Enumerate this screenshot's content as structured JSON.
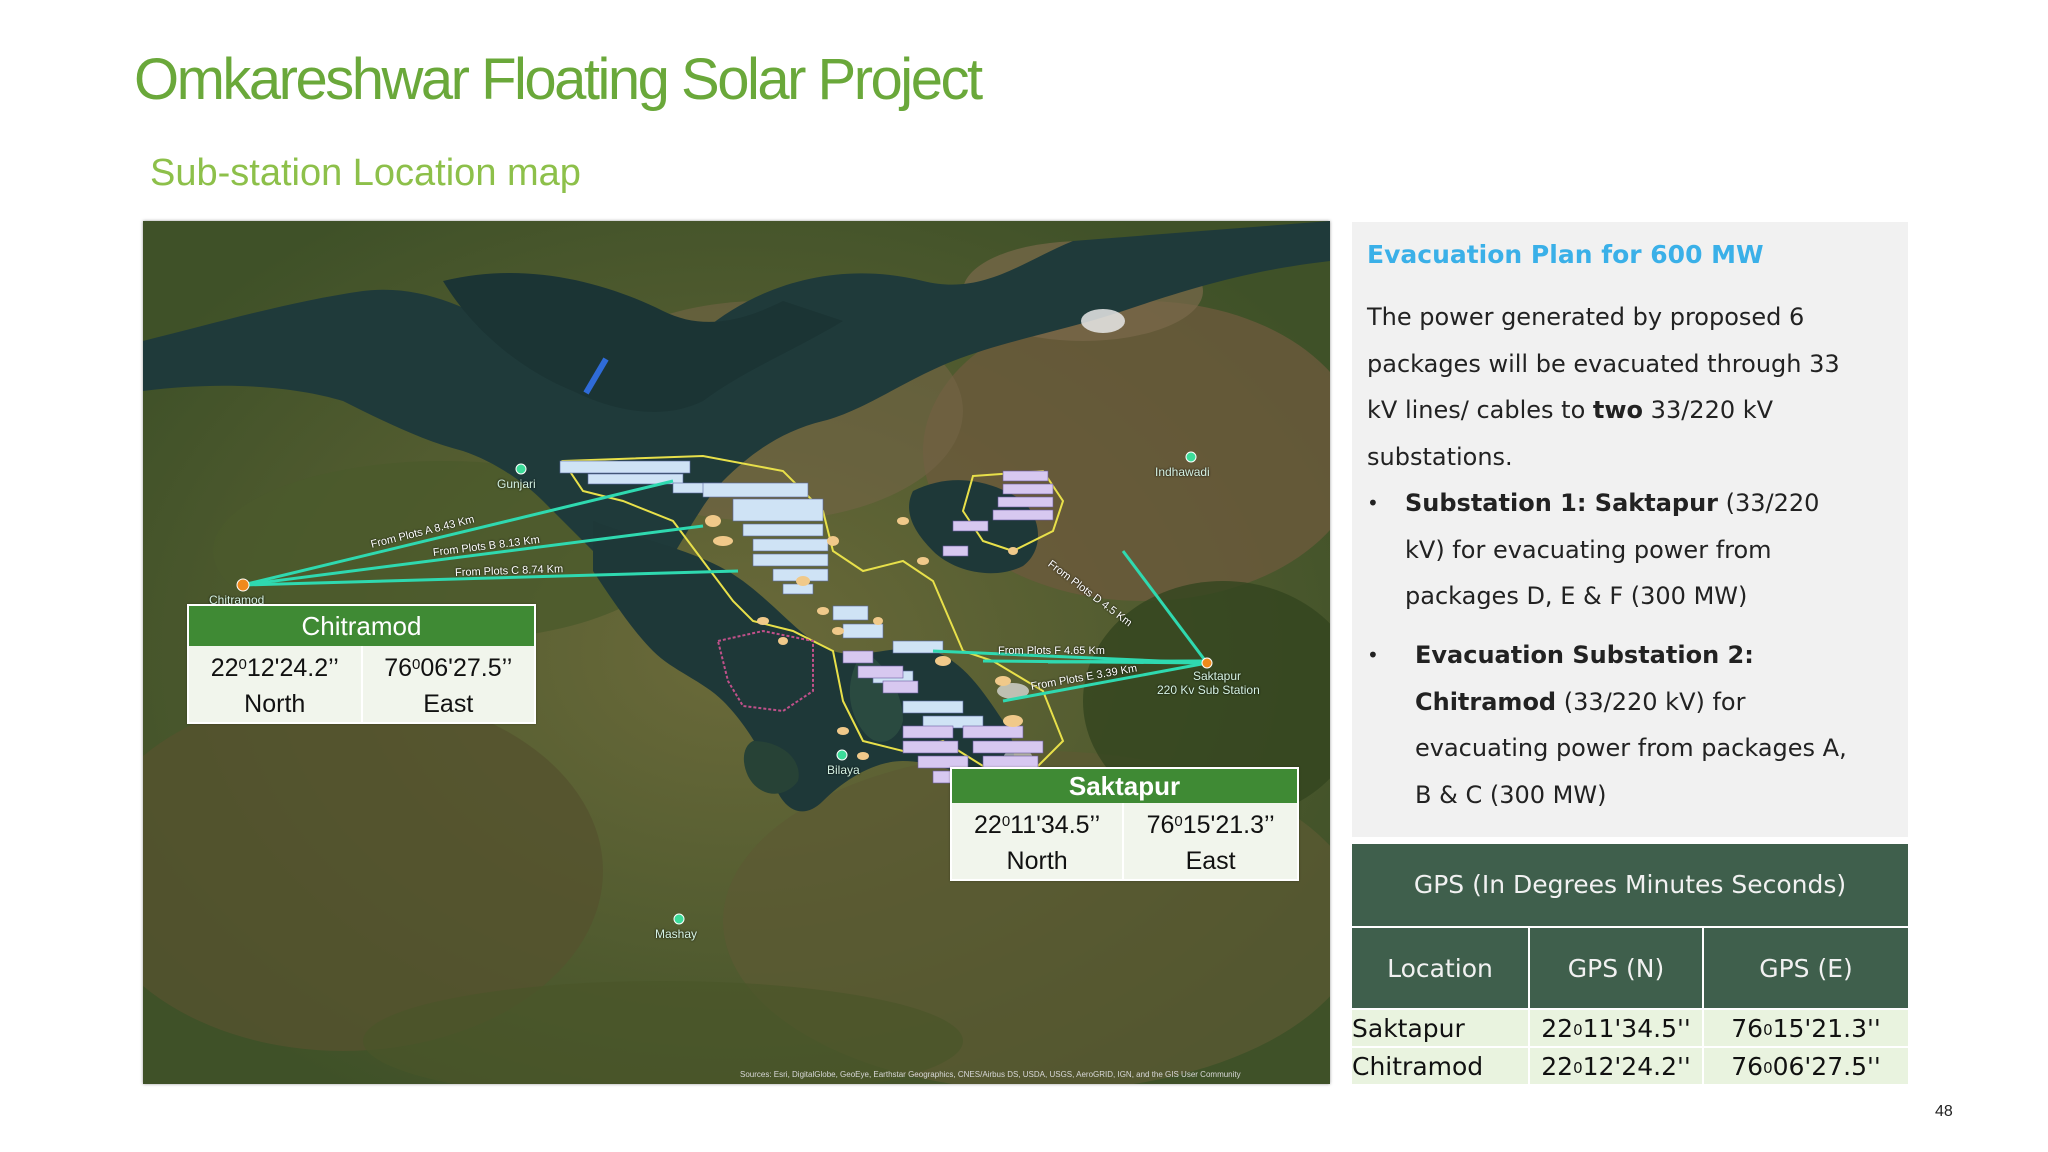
{
  "title": "Omkareshwar Floating Solar Project",
  "subtitle": "Sub-station Location map",
  "map": {
    "places": {
      "gunjari": "Gunjari",
      "indhawadi": "Indhawadi",
      "chitramod": "Chitramod",
      "saktapur": "Saktapur",
      "saktapur_sub": "220 Kv Sub Station",
      "bilaya": "Bilaya",
      "mashay": "Mashay"
    },
    "lines": {
      "a": "From Plots A  8.43  Km",
      "b": "From Plots B  8.13  Km",
      "c": "From Plots C  8.74  Km",
      "d": "From Plots D  4.5  Km",
      "e": "From Plots E  3.39  Km",
      "f": "From Plots F  4.65  Km"
    },
    "attribution": "Sources: Esri, DigitalGlobe, GeoEye, Earthstar Geographics, CNES/Airbus DS, USDA, USGS, AeroGRID, IGN, and the GIS User Community",
    "boxes": {
      "chitramod": {
        "name": "Chitramod",
        "lat_deg": "22",
        "lat_rest": "12'24.2’’",
        "lon_deg": "76",
        "lon_rest": "06'27.5’’",
        "lat_dir": "North",
        "lon_dir": "East"
      },
      "saktapur": {
        "name": "Saktapur",
        "lat_deg": "22",
        "lat_rest": "11'34.5’’",
        "lon_deg": "76",
        "lon_rest": "15'21.3’’",
        "lat_dir": "North",
        "lon_dir": "East"
      }
    }
  },
  "panel": {
    "heading": "Evacuation Plan for 600 MW",
    "intro_1": "The power generated by proposed 6",
    "intro_2": "packages will be evacuated through 33",
    "intro_3a": "kV lines/ cables to ",
    "intro_3b": "two",
    "intro_3c": " 33/220 kV",
    "intro_4": "substations.",
    "b1_bold": "Substation 1: Saktapur",
    "b1_a": " (33/220",
    "b1_b": "kV) for evacuating power from",
    "b1_c": "packages D, E & F (300 MW)",
    "b2_bold_1": "Evacuation Substation 2:",
    "b2_bold_2": "Chitramod",
    "b2_a": " (33/220 kV) for",
    "b2_b": "evacuating power from packages A,",
    "b2_c": "B & C (300 MW)",
    "bullet_char": "•"
  },
  "gps": {
    "caption": "GPS (In Degrees Minutes Seconds)",
    "headers": [
      "Location",
      "GPS (N)",
      "GPS (E)"
    ],
    "rows": [
      {
        "loc": "Saktapur",
        "n_deg": "22",
        "n_rest": "11'34.5''",
        "e_deg": "76",
        "e_rest": "15'21.3''"
      },
      {
        "loc": "Chitramod",
        "n_deg": "22",
        "n_rest": "12'24.2''",
        "e_deg": "76",
        "e_rest": "06'27.5''"
      }
    ]
  },
  "page_number": "48",
  "colors": {
    "title": "#6aa83a",
    "subtitle": "#8dc04a",
    "heading": "#3ab0e8",
    "table_dark": "#3f5f4c",
    "box_header": "#3f8a34",
    "transmission_line": "#2fd9b0"
  }
}
